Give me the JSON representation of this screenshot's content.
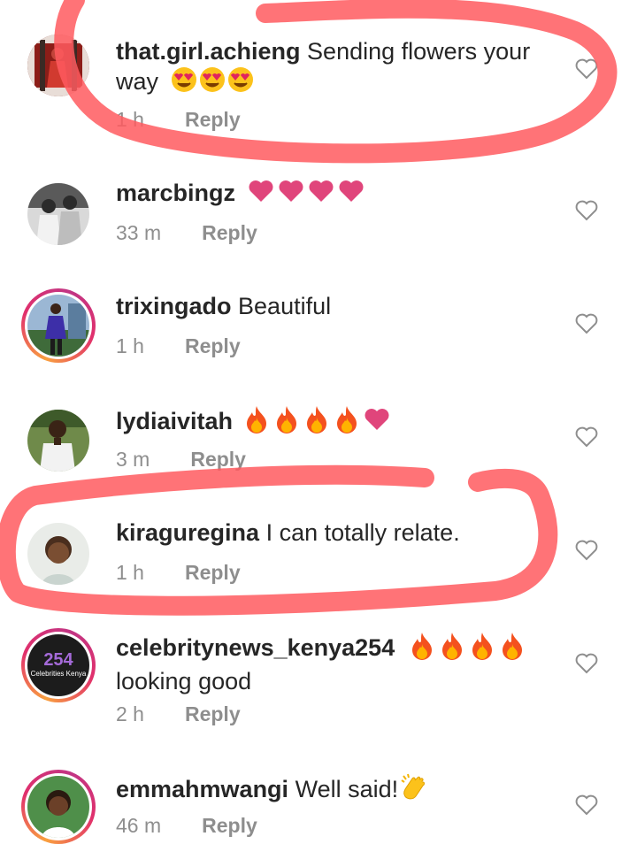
{
  "colors": {
    "username_text": "#262626",
    "meta_text": "#8e8e8e",
    "annotation": "#ff5a5f",
    "heart_pink": "#e0457b",
    "fire": "#f4511e"
  },
  "comments": [
    {
      "username": "that.girl.achieng",
      "text": "Sending flowers your way",
      "emojis": [
        "heart-eyes-emoji",
        "heart-eyes-emoji",
        "heart-eyes-emoji"
      ],
      "time": "1 h",
      "reply": "Reply",
      "story_ring": false
    },
    {
      "username": "marcbingz",
      "text": "",
      "emojis": [
        "pink-heart-emoji",
        "pink-heart-emoji",
        "pink-heart-emoji",
        "pink-heart-emoji"
      ],
      "time": "33 m",
      "reply": "Reply",
      "story_ring": false
    },
    {
      "username": "trixingado",
      "text": "Beautiful",
      "emojis": [],
      "time": "1 h",
      "reply": "Reply",
      "story_ring": true
    },
    {
      "username": "lydiaivitah",
      "text": "",
      "emojis": [
        "fire-emoji",
        "fire-emoji",
        "fire-emoji",
        "fire-emoji",
        "pink-heart-emoji"
      ],
      "time": "3 m",
      "reply": "Reply",
      "story_ring": false
    },
    {
      "username": "kiraguregina",
      "text": "I can totally relate.",
      "emojis": [],
      "time": "1 h",
      "reply": "Reply",
      "story_ring": false
    },
    {
      "username": "celebritynews_kenya254",
      "text": "looking good",
      "emojis": [
        "fire-emoji",
        "fire-emoji",
        "fire-emoji",
        "fire-emoji"
      ],
      "time": "2 h",
      "reply": "Reply",
      "story_ring": true,
      "avatar_text": "254",
      "avatar_sub": "Celebrities Kenya"
    },
    {
      "username": "emmahmwangi",
      "text": "Well said!",
      "emojis": [
        "clapping-hands-emoji"
      ],
      "time": "46 m",
      "reply": "Reply",
      "story_ring": true
    }
  ]
}
